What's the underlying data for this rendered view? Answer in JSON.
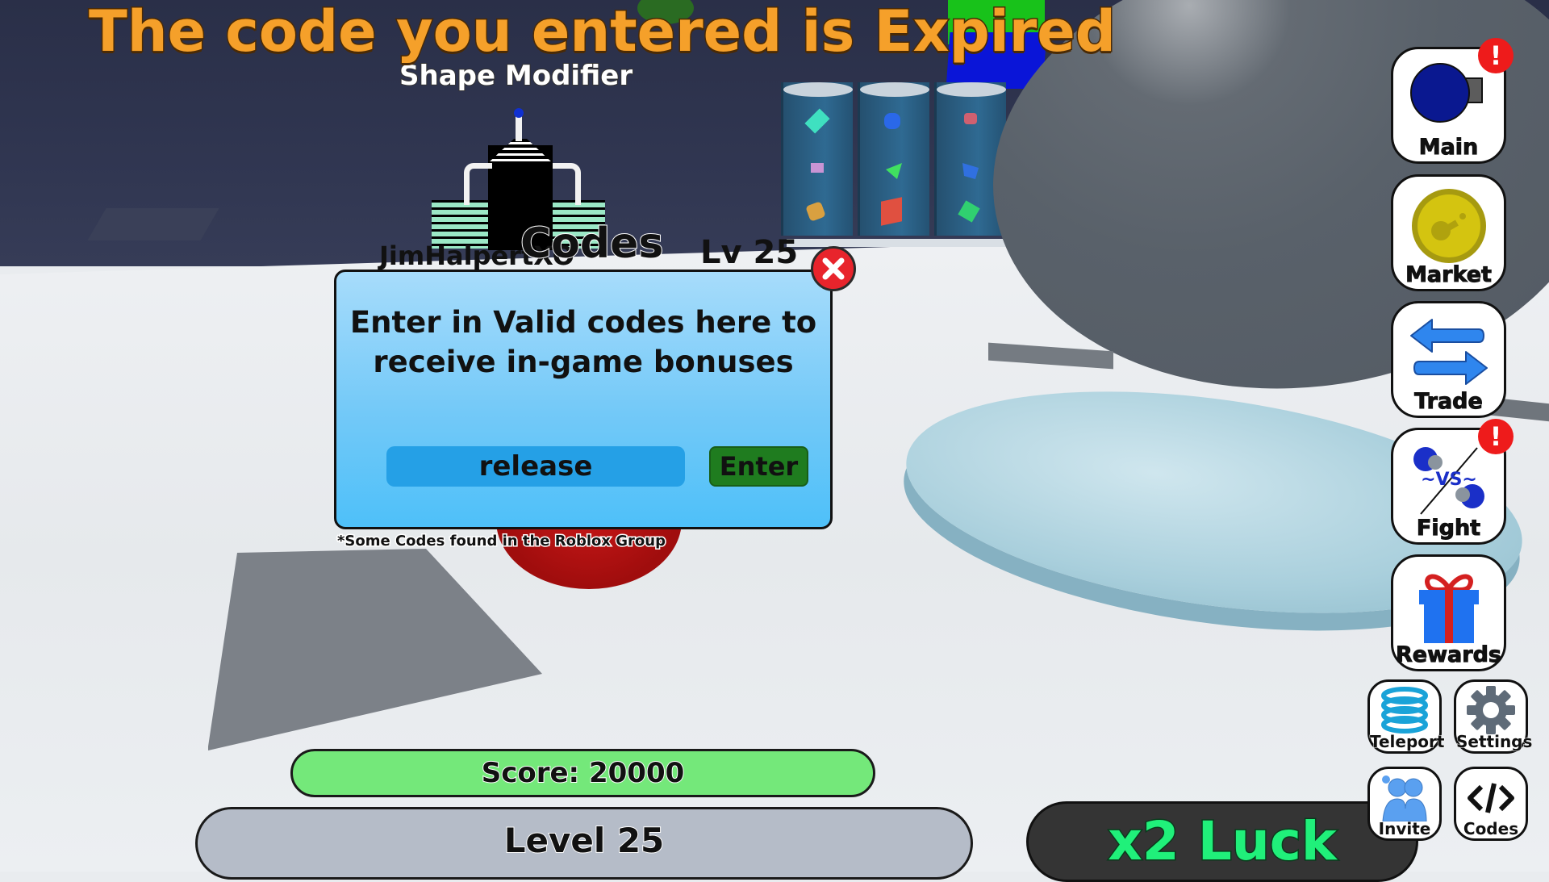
{
  "notification": {
    "message": "The code you entered is Expired",
    "color": "#f5a02a"
  },
  "world": {
    "area_label": "Shape Modifier",
    "player_name": "JimHalpertXO",
    "player_level": "Lv 25"
  },
  "codes_dialog": {
    "title": "Codes",
    "description": "Enter in Valid codes here to receive in-game bonuses",
    "input_value": "release",
    "input_placeholder": "",
    "enter_label": "Enter",
    "close_icon": "close-x-icon",
    "note": "*Some Codes found in the Roblox Group",
    "colors": {
      "panel": "#73c9f8",
      "input": "#25a0e6",
      "enter": "#1f7c1f",
      "close": "#e8242c"
    }
  },
  "stats": {
    "score": "Score: 20000",
    "level": "Level 25",
    "luck": "x2 Luck",
    "colors": {
      "score_bar": "#74e87a",
      "level_bar": "#b5bcc8",
      "luck_text": "#20f07a"
    }
  },
  "side_menu": {
    "items": [
      {
        "label": "Main",
        "icon": "main-orb-icon",
        "alert": true
      },
      {
        "label": "Market",
        "icon": "coin-icon",
        "alert": false
      },
      {
        "label": "Trade",
        "icon": "swap-arrows-icon",
        "alert": false
      },
      {
        "label": "Fight",
        "icon": "versus-icon",
        "alert": true
      },
      {
        "label": "Rewards",
        "icon": "gift-icon",
        "alert": false
      }
    ],
    "small_items": [
      {
        "label": "Teleport",
        "icon": "teleport-rings-icon"
      },
      {
        "label": "Settings",
        "icon": "gear-icon"
      },
      {
        "label": "Invite",
        "icon": "invite-people-icon"
      },
      {
        "label": "Codes",
        "icon": "code-brackets-icon"
      }
    ],
    "alert_glyph": "!"
  }
}
